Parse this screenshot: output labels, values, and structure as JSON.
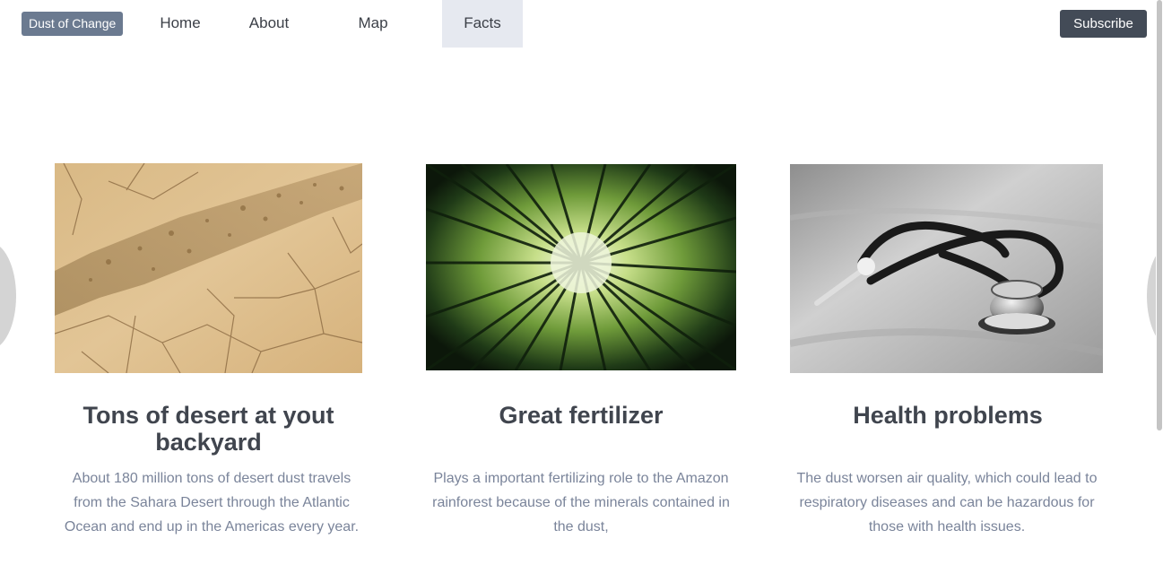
{
  "navbar": {
    "brand": "Dust of Change",
    "items": [
      {
        "label": "Home",
        "active": false
      },
      {
        "label": "About",
        "active": false
      },
      {
        "label": "Map",
        "active": false
      },
      {
        "label": "Facts",
        "active": true
      }
    ],
    "subscribe_label": "Subscribe"
  },
  "colors": {
    "brand_bg": "#6b7a90",
    "active_tab_bg": "#e6e9f0",
    "button_bg": "#434b57",
    "title_text": "#40454e",
    "body_text": "#7a849a"
  },
  "cards": [
    {
      "image": "cracked-desert-ground-image",
      "title": "Tons of desert at yout backyard",
      "text": "About 180 million tons of desert dust travels from the Sahara Desert through the Atlantic Ocean and end up in the Americas every year."
    },
    {
      "image": "bamboo-forest-canopy-image",
      "title": "Great fertilizer",
      "text": "Plays a important fertilizing role to the  Amazon rainforest because of the minerals contained in the dust,"
    },
    {
      "image": "stethoscope-image",
      "title": "Health problems",
      "text": "The dust worsen air quality, which could lead to respiratory diseases and can be hazardous for those with health issues."
    }
  ],
  "icons": {
    "prev": "chevron-left-icon",
    "next": "chevron-right-icon"
  }
}
